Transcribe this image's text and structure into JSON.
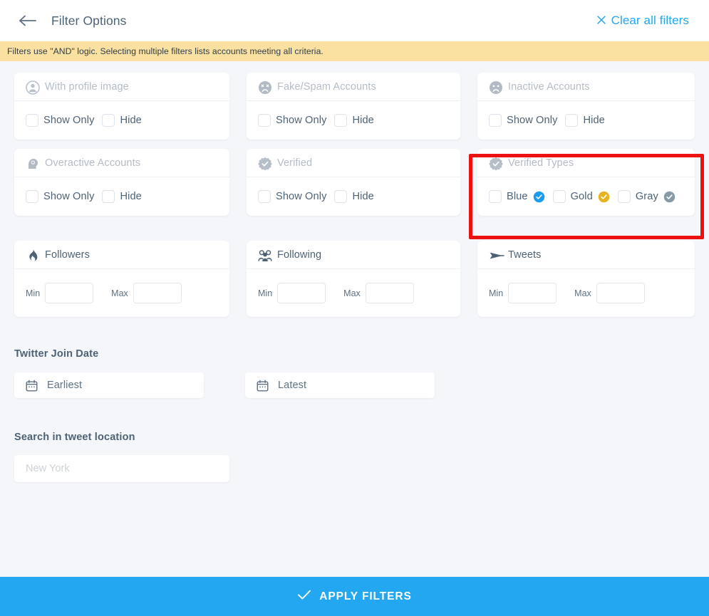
{
  "header": {
    "back_icon": "arrow-left-icon",
    "title": "Filter Options",
    "clear_all_label": "Clear all filters",
    "clear_icon": "close-x-icon",
    "accent_color": "#22a7f0"
  },
  "notice": {
    "text": "Filters use \"AND\" logic. Selecting multiple filters lists accounts meeting all criteria.",
    "background_color": "#fae1a2"
  },
  "filters": [
    {
      "id": "with-profile-image",
      "title": "With profile image",
      "icon": "user-circle-icon",
      "enabled": false,
      "options": [
        {
          "label": "Show Only",
          "checked": false
        },
        {
          "label": "Hide",
          "checked": false
        }
      ]
    },
    {
      "id": "fake-spam-accounts",
      "title": "Fake/Spam Accounts",
      "icon": "dizzy-face-icon",
      "enabled": false,
      "options": [
        {
          "label": "Show Only",
          "checked": false
        },
        {
          "label": "Hide",
          "checked": false
        }
      ]
    },
    {
      "id": "inactive-accounts",
      "title": "Inactive Accounts",
      "icon": "frowning-face-icon",
      "enabled": false,
      "options": [
        {
          "label": "Show Only",
          "checked": false
        },
        {
          "label": "Hide",
          "checked": false
        }
      ]
    },
    {
      "id": "overactive-accounts",
      "title": "Overactive Accounts",
      "icon": "head-brain-icon",
      "enabled": false,
      "options": [
        {
          "label": "Show Only",
          "checked": false
        },
        {
          "label": "Hide",
          "checked": false
        }
      ]
    },
    {
      "id": "verified",
      "title": "Verified",
      "icon": "verified-badge-icon",
      "enabled": false,
      "options": [
        {
          "label": "Show Only",
          "checked": false
        },
        {
          "label": "Hide",
          "checked": false
        }
      ]
    },
    {
      "id": "verified-types",
      "title": "Verified Types",
      "icon": "verified-badge-icon",
      "enabled": false,
      "highlighted": true,
      "options": [
        {
          "label": "Blue",
          "checked": false,
          "badge_color": "#1d9bf0"
        },
        {
          "label": "Gold",
          "checked": false,
          "badge_color": "#e8b321"
        },
        {
          "label": "Gray",
          "checked": false,
          "badge_color": "#869aa8"
        }
      ]
    }
  ],
  "ranges": [
    {
      "id": "followers",
      "title": "Followers",
      "icon": "flame-icon",
      "min_label": "Min",
      "max_label": "Max",
      "min_value": "",
      "max_value": ""
    },
    {
      "id": "following",
      "title": "Following",
      "icon": "users-group-icon",
      "min_label": "Min",
      "max_label": "Max",
      "min_value": "",
      "max_value": ""
    },
    {
      "id": "tweets",
      "title": "Tweets",
      "icon": "paper-plane-icon",
      "min_label": "Min",
      "max_label": "Max",
      "min_value": "",
      "max_value": ""
    }
  ],
  "join_date": {
    "section_title": "Twitter Join Date",
    "earliest": {
      "label": "Earliest",
      "icon": "calendar-icon"
    },
    "latest": {
      "label": "Latest",
      "icon": "calendar-icon"
    }
  },
  "tweet_location": {
    "section_title": "Search in tweet location",
    "placeholder": "New York",
    "value": ""
  },
  "apply": {
    "label": "APPLY FILTERS",
    "icon": "check-icon",
    "background_color": "#22a7f0"
  },
  "highlight": {
    "color": "#ee1111"
  }
}
